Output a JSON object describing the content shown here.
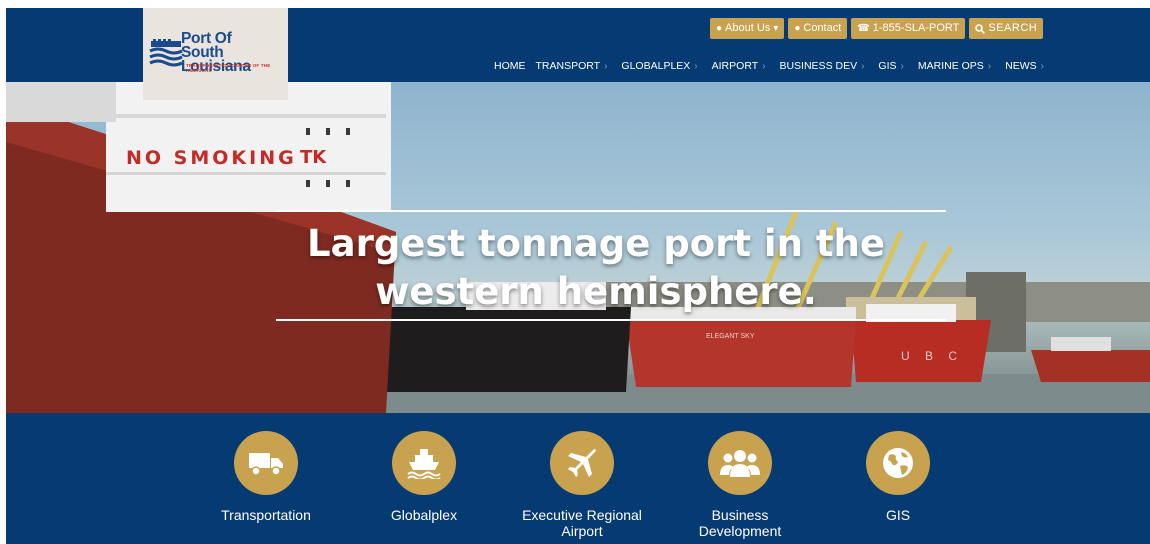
{
  "logo": {
    "line1": "Port Of",
    "line2": "South Louisiana",
    "tagline": "TRANSPORTATION CENTER OF THE AMERICAS"
  },
  "utility": {
    "about": "About Us",
    "contact": "Contact",
    "phone": "1-855-SLA-PORT",
    "search": "SEARCH"
  },
  "nav": [
    "HOME",
    "TRANSPORT",
    "GLOBALPLEX",
    "AIRPORT",
    "BUSINESS DEV",
    "GIS",
    "MARINE OPS",
    "NEWS"
  ],
  "hero": {
    "title_line1": "Largest tonnage port in the",
    "title_line2": "western hemisphere.",
    "ship_text_1": "NO SMOKING",
    "ship_text_2": "TK",
    "ship_text_3": "ELEGANT SKY",
    "ship_text_4": "U B C"
  },
  "features": [
    {
      "label_line1": "Transportation",
      "label_line2": "",
      "icon": "truck-icon"
    },
    {
      "label_line1": "Globalplex",
      "label_line2": "",
      "icon": "ship-icon"
    },
    {
      "label_line1": "Executive Regional",
      "label_line2": "Airport",
      "icon": "plane-icon"
    },
    {
      "label_line1": "Business",
      "label_line2": "Development",
      "icon": "people-icon"
    },
    {
      "label_line1": "GIS",
      "label_line2": "",
      "icon": "globe-icon"
    }
  ],
  "colors": {
    "navy": "#063a73",
    "gold": "#c9a24f",
    "logo_bg": "#e9e4dd"
  }
}
